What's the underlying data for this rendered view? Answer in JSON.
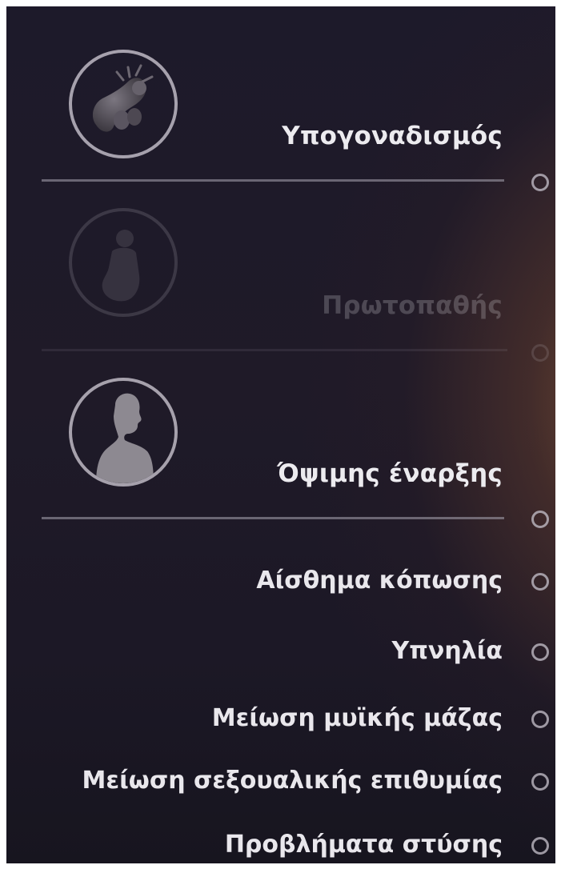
{
  "sections": [
    {
      "label": "Υπογοναδισμός",
      "icon": "anatomy-icon",
      "state": "active"
    },
    {
      "label": "Πρωτοπαθής",
      "icon": "child-silhouette-icon",
      "state": "dimmed"
    },
    {
      "label": "Όψιμης έναρξης",
      "icon": "man-silhouette-icon",
      "state": "active"
    }
  ],
  "symptoms": [
    {
      "label": "Αίσθημα κόπωσης"
    },
    {
      "label": "Υπνηλία"
    },
    {
      "label": "Μείωση μυϊκής μάζας"
    },
    {
      "label": "Μείωση σεξουαλικής επιθυμίας"
    },
    {
      "label": "Προβλήματα στύσης"
    }
  ],
  "colors": {
    "text": "#ecebef",
    "radio_ring": "#bebac3",
    "accent_glow": "#965f32",
    "background": "#1d1a2a"
  }
}
